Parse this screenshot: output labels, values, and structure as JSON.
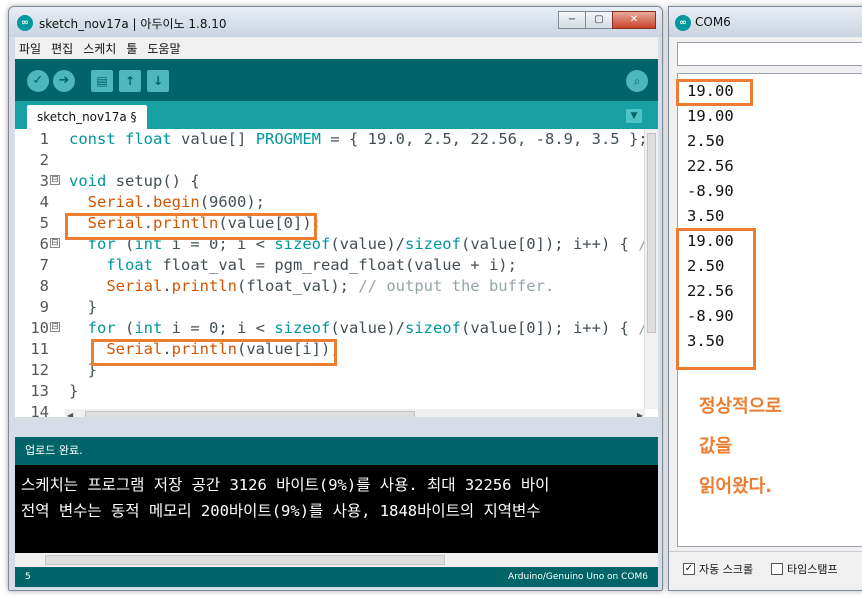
{
  "ide": {
    "title": "sketch_nov17a | 아두이노 1.8.10",
    "logo": "∞",
    "window_buttons": {
      "minimize": "−",
      "maximize": "▢",
      "close": "✕"
    },
    "menu": [
      "파일",
      "편집",
      "스케치",
      "툴",
      "도움말"
    ],
    "toolbar": {
      "verify_icon": "✓",
      "upload_icon": "➜",
      "new_icon": "▤",
      "open_icon": "↑",
      "save_icon": "↓",
      "serial_icon": "⌕"
    },
    "tab": {
      "label": "sketch_nov17a §",
      "menu_icon": "▼"
    },
    "code_lines": [
      {
        "num": "1",
        "fold": "",
        "text": "const float value[] PROGMEM = { 19.0, 2.5, 22.56, -8.9, 3.5 };"
      },
      {
        "num": "2",
        "fold": "",
        "text": ""
      },
      {
        "num": "3",
        "fold": "⊟",
        "text": "void setup() {"
      },
      {
        "num": "4",
        "fold": "",
        "text": "  Serial.begin(9600);"
      },
      {
        "num": "5",
        "fold": "",
        "text": "  Serial.println(value[0]);"
      },
      {
        "num": "6",
        "fold": "⊟",
        "text": "  for (int i = 0; i < sizeof(value)/sizeof(value[0]); i++) { //"
      },
      {
        "num": "7",
        "fold": "",
        "text": "    float float_val = pgm_read_float(value + i);"
      },
      {
        "num": "8",
        "fold": "",
        "text": "    Serial.println(float_val); // output the buffer."
      },
      {
        "num": "9",
        "fold": "",
        "text": "  }"
      },
      {
        "num": "10",
        "fold": "⊟",
        "text": "  for (int i = 0; i < sizeof(value)/sizeof(value[0]); i++) { //"
      },
      {
        "num": "11",
        "fold": "",
        "text": "    Serial.println(value[i]);"
      },
      {
        "num": "12",
        "fold": "",
        "text": "  }"
      },
      {
        "num": "13",
        "fold": "",
        "text": "}"
      },
      {
        "num": "14",
        "fold": "",
        "text": ""
      }
    ],
    "status_text": "업로드 완료.",
    "console_lines": [
      "스케치는 프로그램 저장 공간 3126 바이트(9%)를 사용. 최대 32256 바이",
      "전역 변수는 동적 메모리 200바이트(9%)를 사용, 1848바이트의 지역변수"
    ],
    "footer": {
      "line": "5",
      "board": "Arduino/Genuino Uno on COM6"
    }
  },
  "serial": {
    "title": "COM6",
    "logo": "∞",
    "values": [
      "19.00",
      "19.00",
      "2.50",
      "22.56",
      "-8.90",
      "3.50",
      "19.00",
      "2.50",
      "22.56",
      "-8.90",
      "3.50"
    ],
    "note_lines": [
      "정상적으로",
      "값을",
      "읽어왔다."
    ],
    "autoscroll_label": "자동 스크롤",
    "timestamp_label": "타임스탬프",
    "autoscroll_check": "✓"
  },
  "highlight_color": "#ed7d31"
}
